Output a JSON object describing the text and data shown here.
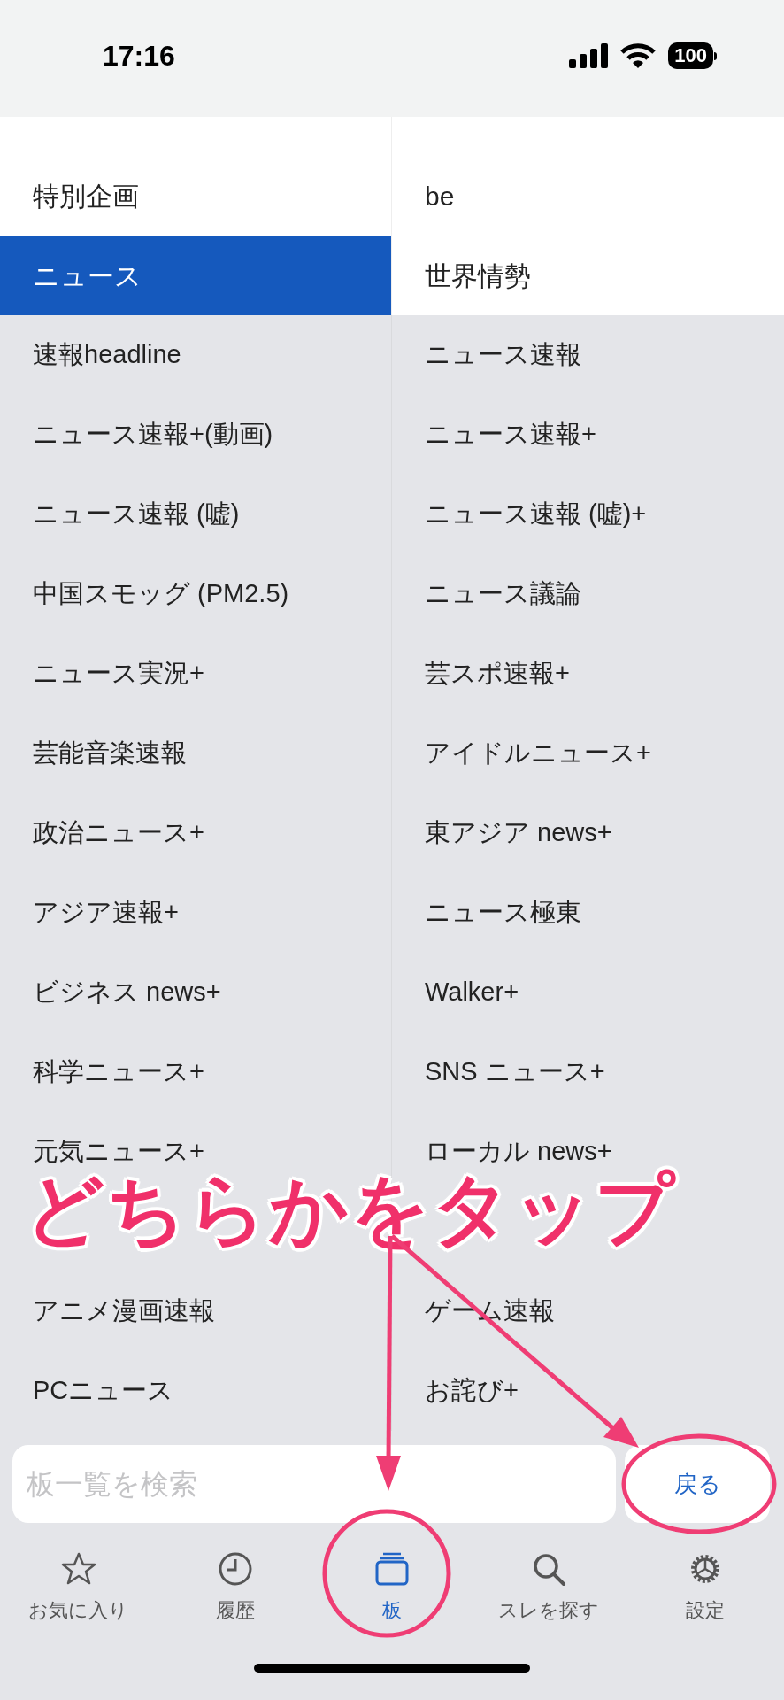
{
  "status_bar": {
    "time": "17:16",
    "battery": "100"
  },
  "categories": [
    {
      "label": "特別企画",
      "selected": false
    },
    {
      "label": "be",
      "selected": false
    },
    {
      "label": "ニュース",
      "selected": true
    },
    {
      "label": "世界情勢",
      "selected": false
    }
  ],
  "boards": [
    "速報headline",
    "ニュース速報",
    "ニュース速報+(動画)",
    "ニュース速報+",
    "ニュース速報 (嘘)",
    "ニュース速報 (嘘)+",
    "中国スモッグ (PM2.5)",
    "ニュース議論",
    "ニュース実況+",
    "芸スポ速報+",
    "芸能音楽速報",
    "アイドルニュース+",
    "政治ニュース+",
    "東アジア news+",
    "アジア速報+",
    "ニュース極東",
    "ビジネス news+",
    "Walker+",
    "科学ニュース+",
    "SNS ニュース+",
    "元気ニュース+",
    "ローカル news+",
    "アニメ漫画速報",
    "ゲーム速報",
    "PCニュース",
    "お詫び+"
  ],
  "search": {
    "placeholder": "板一覧を検索"
  },
  "back_button": "戻る",
  "tabs": [
    {
      "label": "お気に入り",
      "selected": false
    },
    {
      "label": "履歴",
      "selected": false
    },
    {
      "label": "板",
      "selected": true
    },
    {
      "label": "スレを探す",
      "selected": false
    },
    {
      "label": "設定",
      "selected": false
    }
  ],
  "annotation": {
    "text": "どちらかをタップ"
  }
}
